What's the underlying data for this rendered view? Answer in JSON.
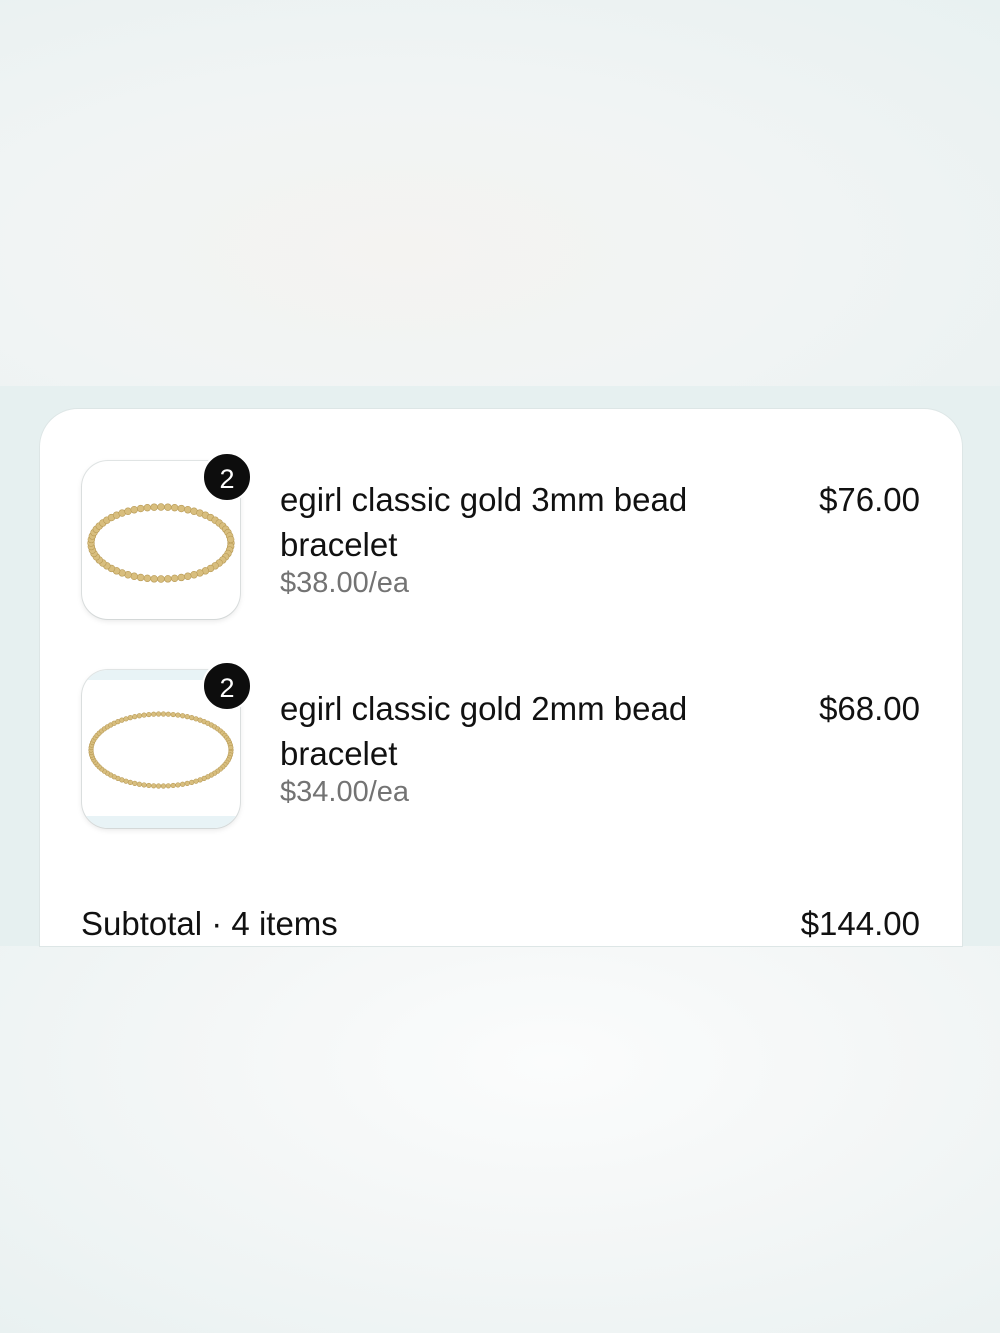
{
  "cart": {
    "items": [
      {
        "title": "egirl classic gold 3mm bead bracelet",
        "unit_price": "$38.00/ea",
        "line_total": "$76.00",
        "quantity": "2",
        "image_icon": "gold-bead-bracelet-image"
      },
      {
        "title": "egirl classic gold 2mm bead bracelet",
        "unit_price": "$34.00/ea",
        "line_total": "$68.00",
        "quantity": "2",
        "image_icon": "gold-bead-bracelet-image"
      }
    ],
    "subtotal_label": "Subtotal · 4 items",
    "subtotal_value": "$144.00"
  },
  "colors": {
    "background": "#e6f0f0",
    "card": "#ffffff",
    "badge": "#0d0d0d",
    "muted_text": "#737373",
    "gold": "#d7bd7c"
  }
}
